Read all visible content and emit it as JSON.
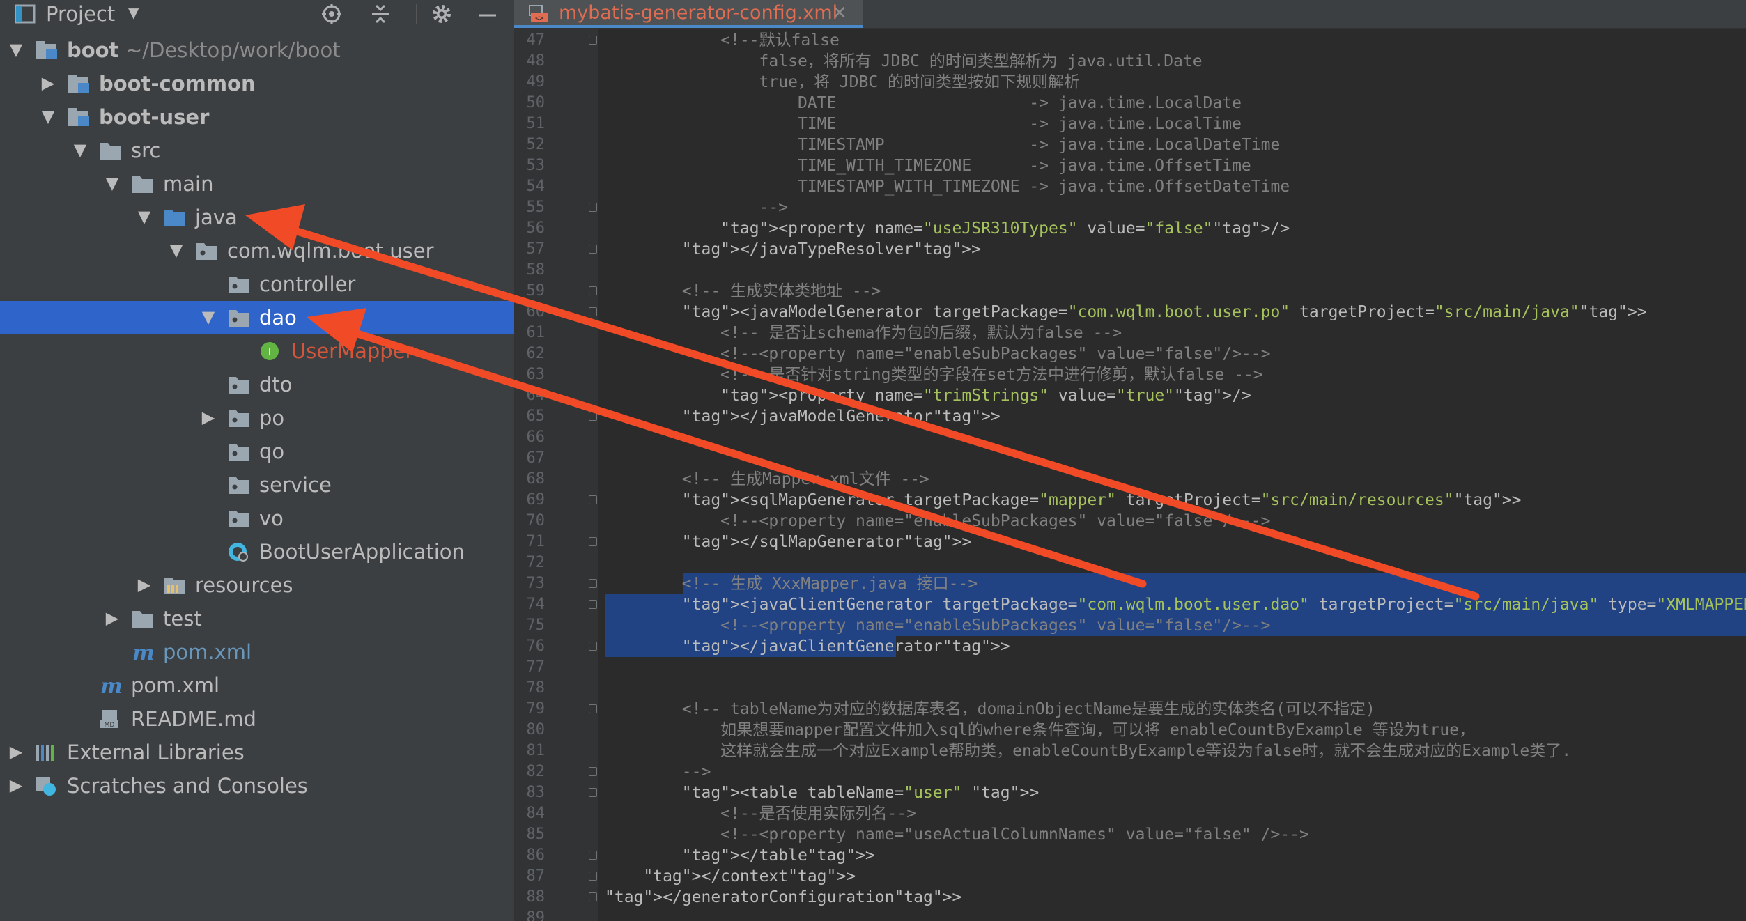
{
  "project_panel": {
    "title": "Project",
    "tree": [
      {
        "label": "boot",
        "path": "~/Desktop/work/boot",
        "bold": true
      },
      {
        "label": "boot-common",
        "bold": true
      },
      {
        "label": "boot-user",
        "bold": true
      },
      {
        "label": "src"
      },
      {
        "label": "main"
      },
      {
        "label": "java"
      },
      {
        "label": "com.wqlm.boot.user"
      },
      {
        "label": "controller"
      },
      {
        "label": "dao",
        "selected": true
      },
      {
        "label": "UserMapper"
      },
      {
        "label": "dto"
      },
      {
        "label": "po"
      },
      {
        "label": "qo"
      },
      {
        "label": "service"
      },
      {
        "label": "vo"
      },
      {
        "label": "BootUserApplication"
      },
      {
        "label": "resources"
      },
      {
        "label": "test"
      },
      {
        "label": "pom.xml"
      },
      {
        "label": "pom.xml"
      },
      {
        "label": "README.md"
      },
      {
        "label": "External Libraries"
      },
      {
        "label": "Scratches and Consoles"
      }
    ]
  },
  "editor": {
    "tab": "mybatis-generator-config.xml",
    "lines": [
      {
        "n": "47",
        "t": "            <!--默认false"
      },
      {
        "n": "48",
        "t": "                false，将所有 JDBC 的时间类型解析为 java.util.Date"
      },
      {
        "n": "49",
        "t": "                true，将 JDBC 的时间类型按如下规则解析"
      },
      {
        "n": "50",
        "t": "                    DATE                    -> java.time.LocalDate"
      },
      {
        "n": "51",
        "t": "                    TIME                    -> java.time.LocalTime"
      },
      {
        "n": "52",
        "t": "                    TIMESTAMP               -> java.time.LocalDateTime"
      },
      {
        "n": "53",
        "t": "                    TIME_WITH_TIMEZONE      -> java.time.OffsetTime"
      },
      {
        "n": "54",
        "t": "                    TIMESTAMP_WITH_TIMEZONE -> java.time.OffsetDateTime"
      },
      {
        "n": "55",
        "t": "                -->"
      },
      {
        "n": "56",
        "t": "            <property name=\"useJSR310Types\" value=\"false\"/>"
      },
      {
        "n": "57",
        "t": "        </javaTypeResolver>"
      },
      {
        "n": "58",
        "t": ""
      },
      {
        "n": "59",
        "t": "        <!-- 生成实体类地址 -->"
      },
      {
        "n": "60",
        "t": "        <javaModelGenerator targetPackage=\"com.wqlm.boot.user.po\" targetProject=\"src/main/java\">"
      },
      {
        "n": "61",
        "t": "            <!-- 是否让schema作为包的后缀，默认为false -->"
      },
      {
        "n": "62",
        "t": "            <!--<property name=\"enableSubPackages\" value=\"false\"/>-->"
      },
      {
        "n": "63",
        "t": "            <!-- 是否针对string类型的字段在set方法中进行修剪，默认false -->"
      },
      {
        "n": "64",
        "t": "            <property name=\"trimStrings\" value=\"true\"/>"
      },
      {
        "n": "65",
        "t": "        </javaModelGenerator>"
      },
      {
        "n": "66",
        "t": ""
      },
      {
        "n": "67",
        "t": ""
      },
      {
        "n": "68",
        "t": "        <!-- 生成Mapper.xml文件 -->"
      },
      {
        "n": "69",
        "t": "        <sqlMapGenerator targetPackage=\"mapper\" targetProject=\"src/main/resources\">"
      },
      {
        "n": "70",
        "t": "            <!--<property name=\"enableSubPackages\" value=\"false\"/>-->"
      },
      {
        "n": "71",
        "t": "        </sqlMapGenerator>"
      },
      {
        "n": "72",
        "t": ""
      },
      {
        "n": "73",
        "t": "        <!-- 生成 XxxMapper.java 接口-->"
      },
      {
        "n": "74",
        "t": "        <javaClientGenerator targetPackage=\"com.wqlm.boot.user.dao\" targetProject=\"src/main/java\" type=\"XMLMAPPER\">"
      },
      {
        "n": "75",
        "t": "            <!--<property name=\"enableSubPackages\" value=\"false\"/>-->"
      },
      {
        "n": "76",
        "t": "        </javaClientGenerator>"
      },
      {
        "n": "77",
        "t": ""
      },
      {
        "n": "78",
        "t": ""
      },
      {
        "n": "79",
        "t": "        <!-- tableName为对应的数据库表名，domainObjectName是要生成的实体类名(可以不指定)"
      },
      {
        "n": "80",
        "t": "            如果想要mapper配置文件加入sql的where条件查询，可以将 enableCountByExample 等设为true，"
      },
      {
        "n": "81",
        "t": "            这样就会生成一个对应Example帮助类，enableCountByExample等设为false时，就不会生成对应的Example类了."
      },
      {
        "n": "82",
        "t": "        -->"
      },
      {
        "n": "83",
        "t": "        <table tableName=\"user\" >"
      },
      {
        "n": "84",
        "t": "            <!--是否使用实际列名-->"
      },
      {
        "n": "85",
        "t": "            <!--<property name=\"useActualColumnNames\" value=\"false\" />-->"
      },
      {
        "n": "86",
        "t": "        </table>"
      },
      {
        "n": "87",
        "t": "    </context>"
      },
      {
        "n": "88",
        "t": "</generatorConfiguration>"
      },
      {
        "n": "89",
        "t": ""
      }
    ]
  },
  "colors": {
    "panel_bg": "#3c3f41",
    "editor_bg": "#2b2b2b",
    "selection": "#2f65ca",
    "code_selection": "#214283",
    "arrow": "#f04a26"
  }
}
